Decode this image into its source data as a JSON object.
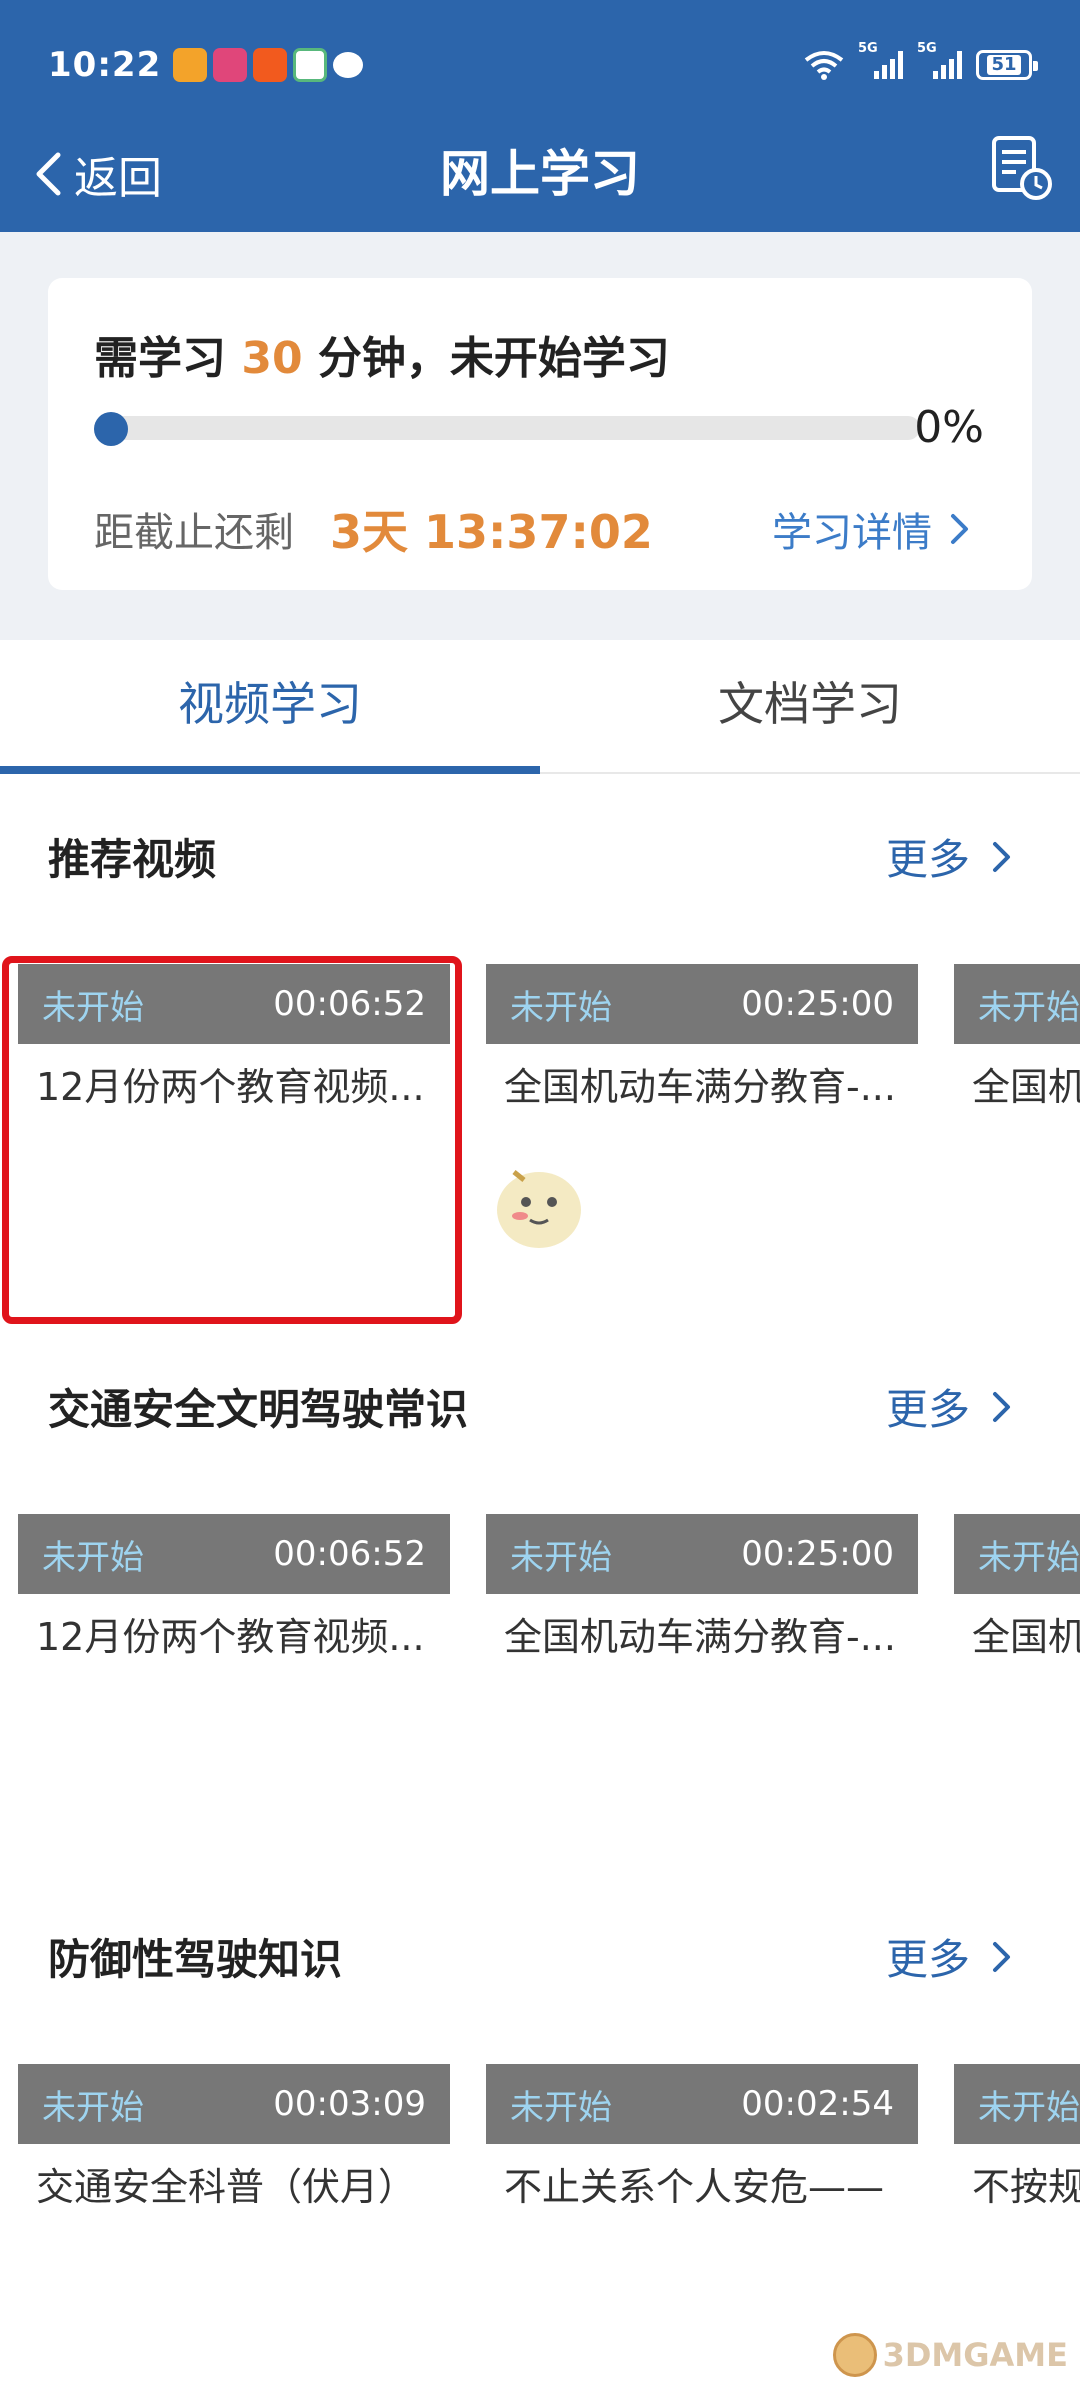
{
  "status_bar": {
    "time": "10:22",
    "network_label_1": "5G",
    "network_label_2": "5G",
    "battery": "51",
    "notification_icons": [
      "app-icon-orange",
      "app-icon-pink",
      "app-icon-taobao",
      "app-icon-green",
      "chat-icon"
    ]
  },
  "nav": {
    "back_label": "返回",
    "title": "网上学习",
    "right_icon": "study-record-icon"
  },
  "progress_card": {
    "title_prefix": "需学习",
    "required_minutes": "30",
    "title_suffix": "分钟，未开始学习",
    "progress_fraction": 0,
    "percent_text": "0%",
    "deadline_label": "距截止还剩",
    "countdown": "3天 13:37:02",
    "detail_link": "学习详情"
  },
  "tabs": [
    {
      "label": "视频学习",
      "active": true
    },
    {
      "label": "文档学习",
      "active": false
    }
  ],
  "sections": [
    {
      "title": "推荐视频",
      "more_label": "更多",
      "videos": [
        {
          "status": "未开始",
          "duration": "00:06:52",
          "title": "12月份两个教育视频..."
        },
        {
          "status": "未开始",
          "duration": "00:25:00",
          "title": "全国机动车满分教育-..."
        },
        {
          "status": "未开始",
          "duration": "",
          "title": "全国机"
        }
      ]
    },
    {
      "title": "交通安全文明驾驶常识",
      "more_label": "更多",
      "videos": [
        {
          "status": "未开始",
          "duration": "00:06:52",
          "title": "12月份两个教育视频..."
        },
        {
          "status": "未开始",
          "duration": "00:25:00",
          "title": "全国机动车满分教育-..."
        },
        {
          "status": "未开始",
          "duration": "",
          "title": "全国机"
        }
      ]
    },
    {
      "title": "防御性驾驶知识",
      "more_label": "更多",
      "videos": [
        {
          "status": "未开始",
          "duration": "00:03:09",
          "title": "交通安全科普（伏月）"
        },
        {
          "status": "未开始",
          "duration": "00:02:54",
          "title": "不止关系个人安危——"
        },
        {
          "status": "未开始",
          "duration": "",
          "title": "不按规"
        }
      ]
    }
  ],
  "watermark": "3DMGAME",
  "colors": {
    "header": "#2c65ab",
    "accent_orange": "#e28a3b",
    "link_blue": "#3c7cc8",
    "status_cyan": "#9ed4f0",
    "highlight_red": "#e0141b"
  }
}
